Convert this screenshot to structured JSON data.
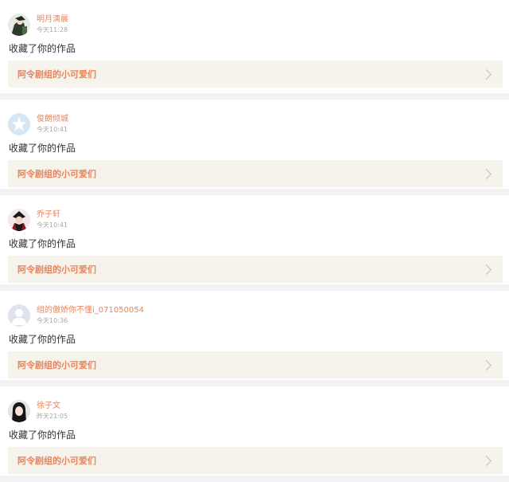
{
  "notifications": [
    {
      "username": "明月清晨",
      "time": "今天11:28",
      "action": "收藏了你的作品",
      "work_title": "阿令剧组的小可爱们",
      "avatar_icon": "user-photo-icon"
    },
    {
      "username": "俊朗倾城",
      "time": "今天10:41",
      "action": "收藏了你的作品",
      "work_title": "阿令剧组的小可爱们",
      "avatar_icon": "default-star-avatar-icon"
    },
    {
      "username": "乔子轩",
      "time": "今天10:41",
      "action": "收藏了你的作品",
      "work_title": "阿令剧组的小可爱们",
      "avatar_icon": "user-photo-icon"
    },
    {
      "username": "组的傲娇你不懂i_071050054",
      "time": "今天10:36",
      "action": "收藏了你的作品",
      "work_title": "阿令剧组的小可爱们",
      "avatar_icon": "default-person-avatar-icon"
    },
    {
      "username": "徐子文",
      "time": "昨天21:05",
      "action": "收藏了你的作品",
      "work_title": "阿令剧组的小可爱们",
      "avatar_icon": "user-photo-icon"
    }
  ],
  "colors": {
    "accent": "#e8845a",
    "link_bg": "#f5f3ec",
    "page_bg": "#f2f2f2"
  }
}
